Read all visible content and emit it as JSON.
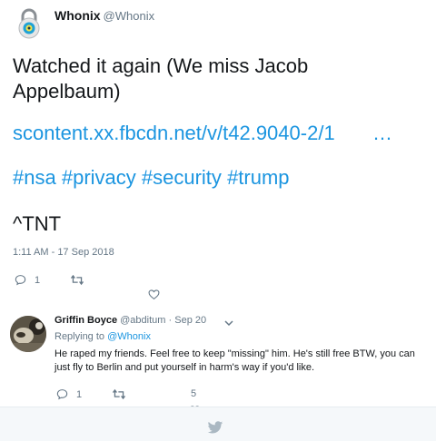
{
  "tweet": {
    "author_name": "Whonix",
    "author_handle": "@Whonix",
    "text_line1": "Watched it again (We miss Jacob",
    "text_line2": "Appelbaum)",
    "link_text": "scontent.xx.fbcdn.net/v/t42.9040-2/1",
    "link_ellipsis": "…",
    "hashtags": [
      "#nsa",
      "#privacy",
      "#security",
      "#trump"
    ],
    "signature": "^TNT",
    "timestamp": "1:11 AM - 17 Sep 2018",
    "reply_count": "1",
    "retweet_count": "",
    "like_count": ""
  },
  "reply": {
    "author_name": "Griffin Boyce",
    "author_handle": "@abditum",
    "date": "· Sep 20",
    "replying_prefix": "Replying to",
    "replying_handle": "@Whonix",
    "text": "He raped my friends. Feel free to keep \"missing\" him. He's still free BTW, you can just fly to Berlin and put yourself in harm's way if you'd like.",
    "reply_count": "1",
    "retweet_count": "",
    "like_count": "5"
  },
  "colors": {
    "link_blue": "#1b95e0",
    "muted_gray": "#657786",
    "text_dark": "#14171a",
    "footer_bg": "#f5f8fa"
  },
  "icons": [
    "lock-avatar-icon",
    "reply-icon",
    "retweet-icon",
    "heart-icon",
    "chevron-down-icon",
    "twitter-bird-icon"
  ]
}
